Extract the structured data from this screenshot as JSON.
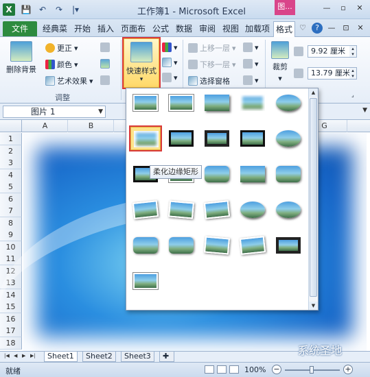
{
  "window": {
    "title": "工作簿1 - Microsoft Excel",
    "context_tab": "图...",
    "controls": [
      "—",
      "▫",
      "✕"
    ],
    "qat": [
      "💾",
      "↶",
      "↷",
      "|▾"
    ]
  },
  "tabs": {
    "file": "文件",
    "items": [
      "经典菜",
      "开始",
      "插入",
      "页面布",
      "公式",
      "数据",
      "审阅",
      "视图",
      "加载项",
      "格式"
    ],
    "active": "格式",
    "help_icons": [
      "♡",
      "?",
      "—",
      "⊡",
      "✕"
    ]
  },
  "ribbon": {
    "remove_bg": "删除背景",
    "corrections": "更正",
    "color": "颜色",
    "art_effects": "艺术效果",
    "adjust_group": "调整",
    "quick_styles": "快速样式",
    "bring_forward": "上移一层",
    "send_backward": "下移一层",
    "selection_pane": "选择窗格",
    "crop": "裁剪",
    "height_value": "9.92 厘米",
    "width_value": "13.79 厘米"
  },
  "formula": {
    "name_box": "图片 1"
  },
  "grid": {
    "columns": [
      "A",
      "B",
      "G"
    ],
    "rows": [
      "1",
      "2",
      "3",
      "4",
      "5",
      "6",
      "7",
      "8",
      "9",
      "10",
      "11",
      "12",
      "13",
      "14",
      "15",
      "16",
      "17",
      "18"
    ]
  },
  "gallery": {
    "tooltip": "柔化边缘矩形",
    "styles": [
      "simple-frame-white",
      "simple-frame-white-2",
      "shadow-rectangle",
      "soft-rectangle",
      "soft-edge-oval-top",
      "soft-edge-rectangle",
      "double-frame-black",
      "thick-matte-black",
      "simple-frame-black",
      "oval-shadow",
      "metal-frame",
      "beveled",
      "reflected-rounded",
      "center-shadow",
      "rounded-diagonal",
      "rotated-white",
      "perspective-shadow",
      "relaxed-perspective",
      "soft-edge-oval",
      "bevel-rounded",
      "bevel-rectangle",
      "metal-rounded",
      "perspective-left",
      "rotated-white-2",
      "reflected-bevel-black",
      "compound-frame"
    ]
  },
  "sheets": {
    "tabs": [
      "Sheet1",
      "Sheet2",
      "Sheet3"
    ],
    "active": "Sheet1"
  },
  "status": {
    "ready": "就绪",
    "zoom": "100%",
    "zoom_level": 1.0
  },
  "watermark": "系统圣地"
}
